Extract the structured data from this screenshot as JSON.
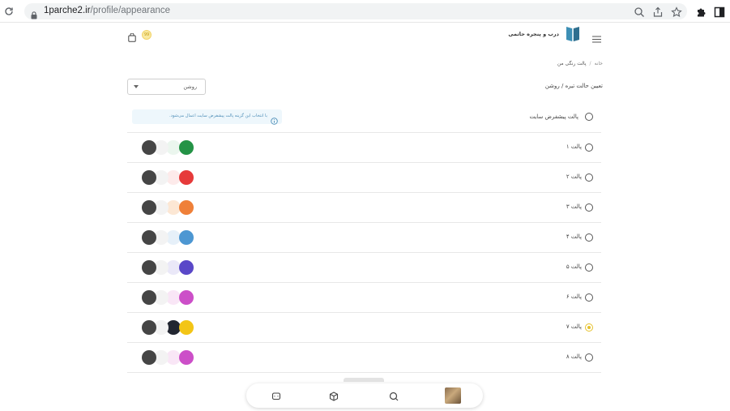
{
  "browser": {
    "url_host": "1parche2.ir",
    "url_path": "/profile/appearance"
  },
  "header": {
    "brand": "درب و پنجره حاتمی",
    "coin_label": "99"
  },
  "breadcrumb": {
    "home": "خانه",
    "separator": "/",
    "current": "پالت رنگی من"
  },
  "mode": {
    "label": "تعیین حالت تیره / روشن",
    "selected": "روشن"
  },
  "default_palette": {
    "label": "پالت پیشفرض سایت",
    "info": "با انتخاب این گزینه پالت پیشفرض سایت اعمال می‌شود."
  },
  "palettes": [
    {
      "label": "پالت ۱",
      "selected": false,
      "colors": [
        "#454545",
        "#f3f3f3",
        "#ebf6ee",
        "#249346"
      ]
    },
    {
      "label": "پالت ۲",
      "selected": false,
      "colors": [
        "#454545",
        "#f3f3f3",
        "#fdeaea",
        "#e63a3a"
      ]
    },
    {
      "label": "پالت ۳",
      "selected": false,
      "colors": [
        "#454545",
        "#f3f3f3",
        "#fce7d4",
        "#ef8039"
      ]
    },
    {
      "label": "پالت ۴",
      "selected": false,
      "colors": [
        "#454545",
        "#f3f3f3",
        "#e6f0f9",
        "#4d97d2"
      ]
    },
    {
      "label": "پالت ۵",
      "selected": false,
      "colors": [
        "#454545",
        "#f3f3f3",
        "#eae8f8",
        "#5a48c8"
      ]
    },
    {
      "label": "پالت ۶",
      "selected": false,
      "colors": [
        "#454545",
        "#f3f3f3",
        "#f9e6f6",
        "#cc4fc8"
      ]
    },
    {
      "label": "پالت ۷",
      "selected": true,
      "colors": [
        "#454545",
        "#f3f3f3",
        "#222631",
        "#f3c516"
      ]
    },
    {
      "label": "پالت ۸",
      "selected": false,
      "colors": [
        "#454545",
        "#f3f3f3",
        "#f9e6f6",
        "#cc4fc8"
      ]
    }
  ],
  "icons": {
    "chrome": [
      "back-icon",
      "reload-icon",
      "lock-icon",
      "zoom-icon",
      "share-icon",
      "bookmark-star-icon",
      "extensions-icon",
      "sidepanel-icon"
    ],
    "bottom_nav": [
      "support-icon",
      "box-icon",
      "search-icon",
      "avatar"
    ]
  },
  "colors": {
    "accent": "#e6c12b",
    "info_text": "#4f8fb8",
    "info_bg": "#eef7fc"
  }
}
